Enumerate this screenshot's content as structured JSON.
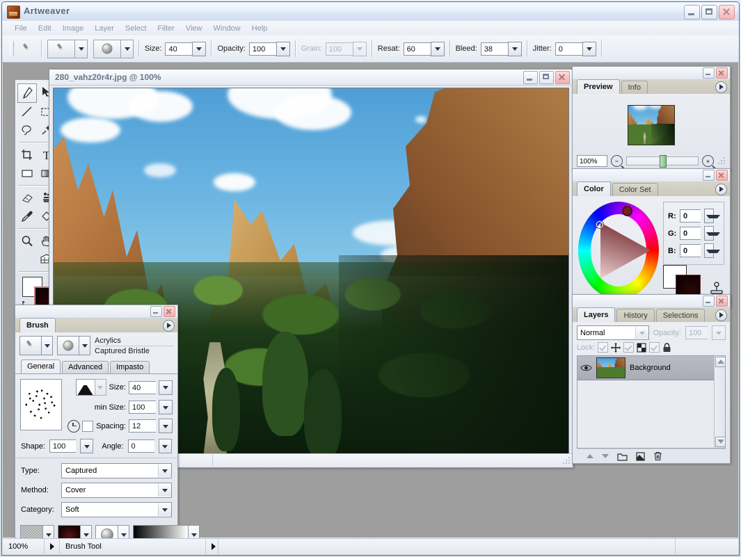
{
  "app": {
    "title": "Artweaver",
    "icon": "app-icon",
    "window_buttons": [
      "minimize",
      "maximize",
      "close"
    ]
  },
  "menu": {
    "items": [
      "File",
      "Edit",
      "Image",
      "Layer",
      "Select",
      "Filter",
      "View",
      "Window",
      "Help"
    ]
  },
  "options_bar": {
    "tool_icon": "brush-icon",
    "brush_preset_icon": "brush-preset-icon",
    "texture_preset_icon": "texture-preset-icon",
    "fields": [
      {
        "label": "Size:",
        "value": "40",
        "enabled": true
      },
      {
        "label": "Opacity:",
        "value": "100",
        "enabled": true
      },
      {
        "label": "Grain:",
        "value": "100",
        "enabled": false
      },
      {
        "label": "Resat:",
        "value": "60",
        "enabled": true
      },
      {
        "label": "Bleed:",
        "value": "38",
        "enabled": true
      },
      {
        "label": "Jitter:",
        "value": "0",
        "enabled": true
      }
    ]
  },
  "toolbox": {
    "tools": [
      {
        "name": "brush-tool",
        "selected": true
      },
      {
        "name": "move-tool",
        "selected": false
      },
      {
        "name": "line-tool",
        "selected": false
      },
      {
        "name": "rect-select-tool",
        "selected": false
      },
      {
        "name": "lasso-tool",
        "selected": false
      },
      {
        "name": "magic-wand-tool",
        "selected": false
      },
      {
        "name": "crop-tool",
        "selected": false
      },
      {
        "name": "text-tool",
        "selected": false
      },
      {
        "name": "rectangle-tool",
        "selected": false
      },
      {
        "name": "gradient-tool",
        "selected": false
      },
      {
        "name": "eraser-tool",
        "selected": false
      },
      {
        "name": "clone-stamp-tool",
        "selected": false
      },
      {
        "name": "eyedropper-tool",
        "selected": false
      },
      {
        "name": "paint-bucket-tool",
        "selected": false
      },
      {
        "name": "zoom-tool",
        "selected": false
      },
      {
        "name": "hand-tool",
        "selected": false
      },
      {
        "name": "grid-tool",
        "selected": false
      }
    ],
    "foreground_color": "#ffffff",
    "background_color": "#1a0303"
  },
  "document": {
    "title": "280_vahz20r4r.jpg @ 100%",
    "window_buttons": [
      "minimize",
      "maximize",
      "close"
    ],
    "status": {
      "zoom": "100%",
      "tool": "Brush Tool"
    }
  },
  "preview_panel": {
    "tabs": [
      {
        "label": "Preview",
        "active": true
      },
      {
        "label": "Info",
        "active": false
      }
    ],
    "zoom_value": "100%",
    "zoom_out_icon": "zoom-out-icon",
    "zoom_in_icon": "zoom-in-icon",
    "menu_icon": "panel-menu-icon"
  },
  "color_panel": {
    "tabs": [
      {
        "label": "Color",
        "active": true
      },
      {
        "label": "Color Set",
        "active": false
      }
    ],
    "channels": [
      {
        "label": "R:",
        "value": "0"
      },
      {
        "label": "G:",
        "value": "0"
      },
      {
        "label": "B:",
        "value": "0"
      }
    ],
    "foreground_color": "#ffffff",
    "background_color": "#1a0303",
    "picker_icon": "color-picker-icon",
    "menu_icon": "panel-menu-icon"
  },
  "layers_panel": {
    "tabs": [
      {
        "label": "Layers",
        "active": true
      },
      {
        "label": "History",
        "active": false
      },
      {
        "label": "Selections",
        "active": false
      }
    ],
    "blend_mode": "Normal",
    "opacity_label": "Opacity:",
    "opacity_value": "100",
    "lock_label": "Lock:",
    "lock_icons": [
      "lock-move-icon",
      "lock-transparency-icon",
      "lock-all-icon"
    ],
    "layers": [
      {
        "name": "Background",
        "visible": true,
        "locked": true,
        "selected": true
      }
    ],
    "footer_icons": [
      "move-layer-up-icon",
      "move-layer-down-icon",
      "new-group-icon",
      "new-layer-icon",
      "delete-layer-icon"
    ],
    "menu_icon": "panel-menu-icon"
  },
  "brush_panel": {
    "title_tab": "Brush",
    "menu_icon": "panel-menu-icon",
    "variant_icon": "brush-variant-icon",
    "texture_icon": "brush-texture-icon",
    "category_name": "Acrylics",
    "variant_name": "Captured Bristle",
    "tabs": [
      {
        "label": "General",
        "active": true
      },
      {
        "label": "Advanced",
        "active": false
      },
      {
        "label": "Impasto",
        "active": false
      }
    ],
    "general": {
      "size_label": "Size:",
      "size_value": "40",
      "min_size_label": "min Size:",
      "min_size_value": "100",
      "spacing_label": "Spacing:",
      "spacing_value": "12",
      "shape_label": "Shape:",
      "shape_value": "100",
      "angle_label": "Angle:",
      "angle_value": "0",
      "curve_icon": "brush-profile-icon",
      "timing_icon": "timing-clock-icon"
    },
    "selects": [
      {
        "label": "Type:",
        "value": "Captured"
      },
      {
        "label": "Method:",
        "value": "Cover"
      },
      {
        "label": "Category:",
        "value": "Soft"
      }
    ],
    "material_pickers": [
      "paper-texture-picker",
      "pattern-picker",
      "grain-picker",
      "gradient-picker"
    ]
  },
  "status_bar": {
    "zoom": "100%",
    "tool": "Brush Tool"
  }
}
